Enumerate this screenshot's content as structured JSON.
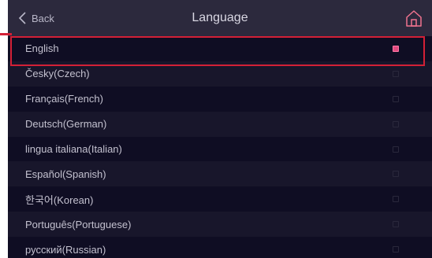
{
  "header": {
    "back_label": "Back",
    "title": "Language"
  },
  "languages": [
    {
      "label": "English",
      "selected": true
    },
    {
      "label": "Česky(Czech)",
      "selected": false
    },
    {
      "label": "Français(French)",
      "selected": false
    },
    {
      "label": "Deutsch(German)",
      "selected": false
    },
    {
      "label": "lingua italiana(Italian)",
      "selected": false
    },
    {
      "label": "Español(Spanish)",
      "selected": false
    },
    {
      "label": "한국어(Korean)",
      "selected": false
    },
    {
      "label": "Português(Portuguese)",
      "selected": false
    },
    {
      "label": "русский(Russian)",
      "selected": false
    }
  ],
  "colors": {
    "background": "#0f0d23",
    "header": "#2c293d",
    "accent_check": "#e24a80",
    "home_icon": "#f0738f",
    "annotation": "#d32036"
  },
  "icons": {
    "back": "chevron-left-icon",
    "home": "home-icon"
  }
}
